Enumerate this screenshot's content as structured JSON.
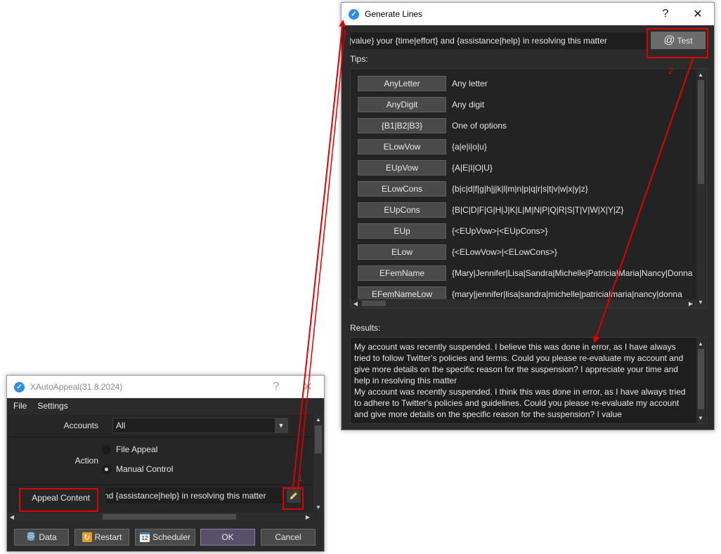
{
  "generate_window": {
    "title": "Generate Lines",
    "help": "?",
    "close": "✕",
    "pattern_value": "e|value} your {time|effort} and {assistance|help} in resolving this matter",
    "test_label": "Test",
    "test_icon": "@",
    "tips_label": "Tips:",
    "tips": [
      {
        "name": "AnyLetter",
        "desc": "Any letter"
      },
      {
        "name": "AnyDigit",
        "desc": "Any digit"
      },
      {
        "name": "{B1|B2|B3}",
        "desc": "One of options"
      },
      {
        "name": "ELowVow",
        "desc": "{a|e|i|o|u}"
      },
      {
        "name": "EUpVow",
        "desc": "{A|E|I|O|U}"
      },
      {
        "name": "ELowCons",
        "desc": "{b|c|d|f|g|h|j|k|l|m|n|p|q|r|s|t|v|w|x|y|z}"
      },
      {
        "name": "EUpCons",
        "desc": "{B|C|D|F|G|H|J|K|L|M|N|P|Q|R|S|T|V|W|X|Y|Z}"
      },
      {
        "name": "EUp",
        "desc": "{<EUpVow>|<EUpCons>}"
      },
      {
        "name": "ELow",
        "desc": "{<ELowVow>|<ELowCons>}"
      },
      {
        "name": "EFemName",
        "desc": "{Mary|Jennifer|Lisa|Sandra|Michelle|Patricia|Maria|Nancy|Donna"
      },
      {
        "name": "EFemNameLow",
        "desc": "{mary|jennifer|lisa|sandra|michelle|patricia|maria|nancy|donna"
      }
    ],
    "results_label": "Results:",
    "results_text": "My account was recently suspended. I believe this was done in error, as I have always tried to follow Twitter's policies and terms. Could you please re-evaluate my account and give more details on the specific reason for the suspension? I appreciate your time and help in resolving this matter\nMy account was recently suspended. I think this was done in error, as I have always tried to adhere to Twitter's policies and guidelines. Could you please re-evaluate my account and give more details on the specific reason for the suspension? I value"
  },
  "xautoappeal_window": {
    "title": "XAutoAppeal(31.8.2024)",
    "help": "?",
    "close": "✕",
    "menu": [
      "File",
      "Settings"
    ],
    "accounts_label": "Accounts",
    "accounts_value": "All",
    "action_label": "Action",
    "action_options": [
      "File Appeal",
      "Manual Control"
    ],
    "action_selected": "Manual Control",
    "appeal_label": "Appeal Content",
    "appeal_value": "nd {assistance|help} in resolving this matter",
    "buttons": {
      "data": "Data",
      "restart": "Restart",
      "scheduler": "Scheduler",
      "ok": "OK",
      "cancel": "Cancel"
    },
    "scheduler_icon_text": "12"
  },
  "annotations": {
    "num1": "1",
    "num2": "2",
    "color": "#e00000"
  }
}
